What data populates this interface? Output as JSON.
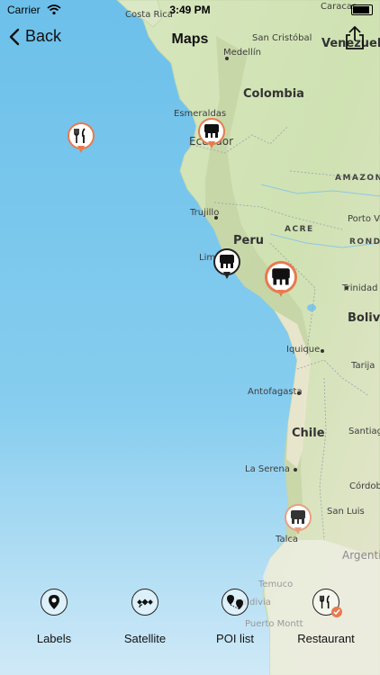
{
  "status_bar": {
    "carrier": "Carrier",
    "time": "3:49 PM"
  },
  "nav": {
    "back_label": "Back",
    "title": "Maps"
  },
  "map": {
    "labels": [
      {
        "text": "Costa Rica",
        "kind": "city"
      },
      {
        "text": "Caracas",
        "kind": "city"
      },
      {
        "text": "San Cristóbal",
        "kind": "city"
      },
      {
        "text": "Venezuela",
        "kind": "country"
      },
      {
        "text": "Medellín",
        "kind": "city"
      },
      {
        "text": "Colombia",
        "kind": "country"
      },
      {
        "text": "Esmeraldas",
        "kind": "city"
      },
      {
        "text": "Ecuador",
        "kind": "city"
      },
      {
        "text": "AMAZONA",
        "kind": "region"
      },
      {
        "text": "Trujillo",
        "kind": "city"
      },
      {
        "text": "Porto Ve",
        "kind": "city"
      },
      {
        "text": "ACRE",
        "kind": "region"
      },
      {
        "text": "Peru",
        "kind": "country"
      },
      {
        "text": "RONDÔ",
        "kind": "region"
      },
      {
        "text": "Lima",
        "kind": "city"
      },
      {
        "text": "Trinidad",
        "kind": "city"
      },
      {
        "text": "Bolivia",
        "kind": "country"
      },
      {
        "text": "Iquique",
        "kind": "city"
      },
      {
        "text": "Tarija",
        "kind": "city"
      },
      {
        "text": "Antofagasta",
        "kind": "city"
      },
      {
        "text": "Chile",
        "kind": "country"
      },
      {
        "text": "Santiago del Estero",
        "kind": "city"
      },
      {
        "text": "La Serena",
        "kind": "city"
      },
      {
        "text": "Córdoba",
        "kind": "city"
      },
      {
        "text": "San Luis",
        "kind": "city"
      },
      {
        "text": "Talca",
        "kind": "city"
      },
      {
        "text": "Argentina",
        "kind": "country"
      },
      {
        "text": "Temuco",
        "kind": "city"
      },
      {
        "text": "Valdivia",
        "kind": "city"
      },
      {
        "text": "Puerto Montt",
        "kind": "city"
      }
    ],
    "pins": [
      {
        "name": "restaurant-pin",
        "icon": "fork-knife-icon"
      },
      {
        "name": "hotel-pin",
        "icon": "teeth-icon"
      },
      {
        "name": "lima-pin",
        "icon": "teeth-icon"
      },
      {
        "name": "cusco-pin",
        "icon": "teeth-icon"
      },
      {
        "name": "santiago-pin",
        "icon": "teeth-icon"
      }
    ],
    "colors": {
      "ocean": "#7cc8ec",
      "land": "#dbe8c6",
      "pin_border": "#e87a4f"
    }
  },
  "toolbar": {
    "items": [
      {
        "label": "Labels",
        "icon": "location-pin-icon"
      },
      {
        "label": "Satellite",
        "icon": "satellite-icon"
      },
      {
        "label": "POI list",
        "icon": "poi-list-icon"
      },
      {
        "label": "Restaurant",
        "icon": "restaurant-icon"
      }
    ]
  }
}
